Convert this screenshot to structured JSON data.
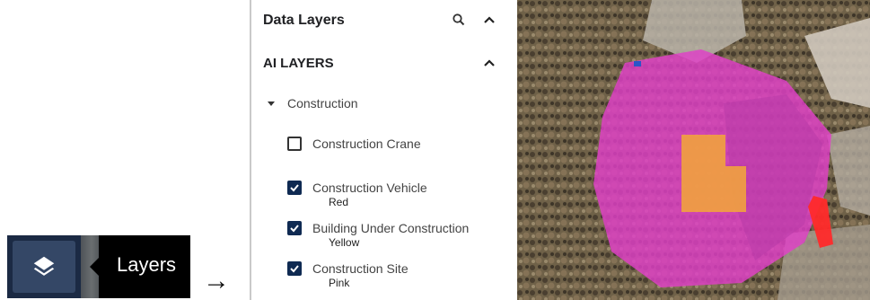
{
  "tooltip": {
    "label": "Layers"
  },
  "icons": {
    "layers": "layers-icon",
    "arrow": "right-arrow",
    "search": "search-icon",
    "collapse": "chevron-up-icon",
    "expand_group": "caret-down-icon"
  },
  "panel": {
    "title": "Data Layers",
    "section": "AI LAYERS",
    "group": "Construction",
    "layers": [
      {
        "label": "Construction Crane",
        "checked": false,
        "color": ""
      },
      {
        "label": "Construction Vehicle",
        "checked": true,
        "color": "Red"
      },
      {
        "label": "Building Under Construction",
        "checked": true,
        "color": "Yellow"
      },
      {
        "label": "Construction Site",
        "checked": true,
        "color": "Pink"
      }
    ]
  },
  "colors": {
    "checkbox_checked": "#0f2a52",
    "construction_site_overlay": "#e040c8",
    "building_overlay": "#f0a040",
    "vehicle_overlay": "#ff2a2a"
  }
}
